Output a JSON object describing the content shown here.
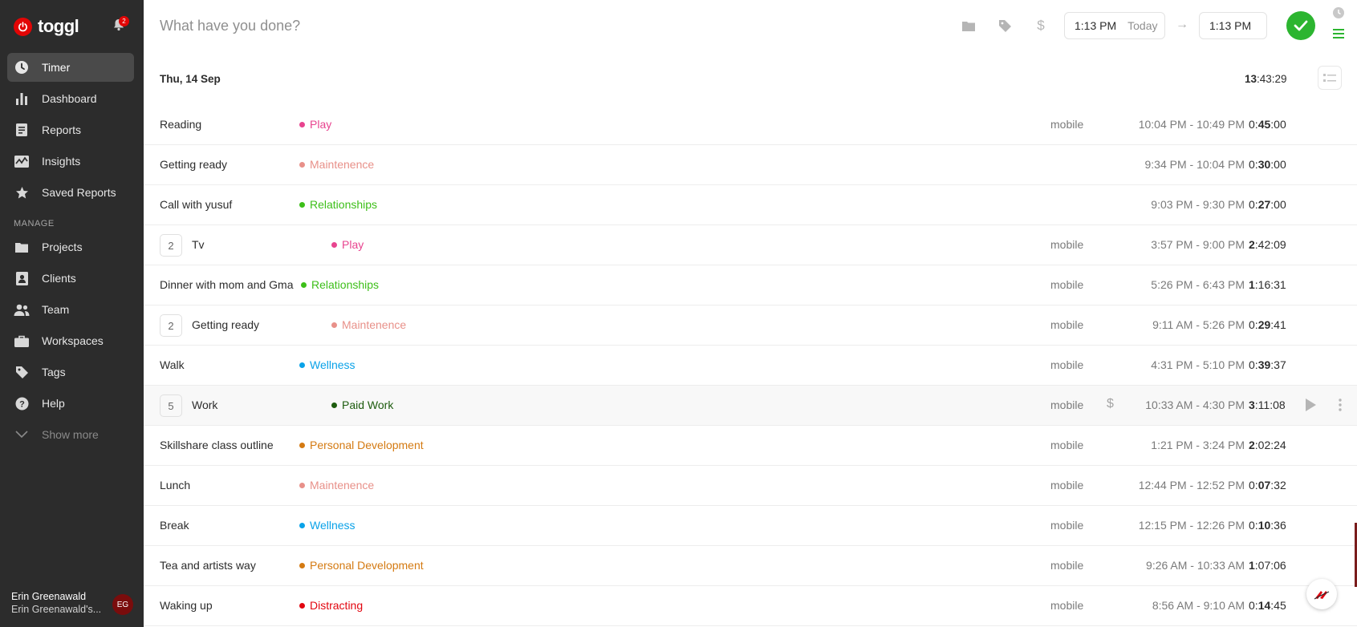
{
  "app": {
    "name": "toggl",
    "notification_count": "2"
  },
  "sidebar": {
    "items": [
      {
        "key": "timer",
        "label": "Timer",
        "icon": "clock-icon",
        "active": true
      },
      {
        "key": "dashboard",
        "label": "Dashboard",
        "icon": "bar-chart-icon"
      },
      {
        "key": "reports",
        "label": "Reports",
        "icon": "document-icon"
      },
      {
        "key": "insights",
        "label": "Insights",
        "icon": "pulse-chart-icon"
      },
      {
        "key": "saved-reports",
        "label": "Saved Reports",
        "icon": "star-icon"
      }
    ],
    "manage_label": "MANAGE",
    "manage_items": [
      {
        "key": "projects",
        "label": "Projects",
        "icon": "folder-icon"
      },
      {
        "key": "clients",
        "label": "Clients",
        "icon": "contact-card-icon"
      },
      {
        "key": "team",
        "label": "Team",
        "icon": "people-icon"
      },
      {
        "key": "workspaces",
        "label": "Workspaces",
        "icon": "briefcase-icon"
      },
      {
        "key": "tags",
        "label": "Tags",
        "icon": "tag-icon"
      },
      {
        "key": "help",
        "label": "Help",
        "icon": "help-icon"
      }
    ],
    "show_more": "Show more",
    "user": {
      "name": "Erin Greenawald",
      "workspace": "Erin Greenawald's...",
      "initials": "EG"
    }
  },
  "timer_bar": {
    "placeholder": "What have you done?",
    "start_time": "1:13 PM",
    "start_day": "Today",
    "end_time": "1:13 PM"
  },
  "day": {
    "title": "Thu, 14 Sep",
    "total_prefix": "13",
    "total_rest": ":43:29"
  },
  "entries": [
    {
      "count": "",
      "description": "Reading",
      "project": "Play",
      "color": "#e8448f",
      "tag": "mobile",
      "billable": false,
      "range": "10:04 PM - 10:49 PM",
      "dur_h": "0:",
      "dur_m": "45",
      "dur_s": ":00"
    },
    {
      "count": "",
      "description": "Getting ready",
      "project": "Maintenence",
      "color": "#e89089",
      "tag": "",
      "billable": false,
      "range": "9:34 PM - 10:04 PM",
      "dur_h": "0:",
      "dur_m": "30",
      "dur_s": ":00"
    },
    {
      "count": "",
      "description": "Call with yusuf",
      "project": "Relationships",
      "color": "#3dbf19",
      "tag": "",
      "billable": false,
      "range": "9:03 PM - 9:30 PM",
      "dur_h": "0:",
      "dur_m": "27",
      "dur_s": ":00"
    },
    {
      "count": "2",
      "description": "Tv",
      "project": "Play",
      "color": "#e8448f",
      "tag": "mobile",
      "billable": false,
      "range": "3:57 PM - 9:00 PM",
      "dur_h": "2",
      "dur_m": "",
      "dur_s": ":42:09"
    },
    {
      "count": "",
      "description": "Dinner with mom and Gma",
      "project": "Relationships",
      "color": "#3dbf19",
      "tag": "mobile",
      "billable": false,
      "range": "5:26 PM - 6:43 PM",
      "dur_h": "1",
      "dur_m": "",
      "dur_s": ":16:31"
    },
    {
      "count": "2",
      "description": "Getting ready",
      "project": "Maintenence",
      "color": "#e89089",
      "tag": "mobile",
      "billable": false,
      "range": "9:11 AM - 5:26 PM",
      "dur_h": "0:",
      "dur_m": "29",
      "dur_s": ":41"
    },
    {
      "count": "",
      "description": "Walk",
      "project": "Wellness",
      "color": "#0aa2e8",
      "tag": "mobile",
      "billable": false,
      "range": "4:31 PM - 5:10 PM",
      "dur_h": "0:",
      "dur_m": "39",
      "dur_s": ":37"
    },
    {
      "count": "5",
      "description": "Work",
      "project": "Paid Work",
      "color": "#1d5c0e",
      "tag": "mobile",
      "billable": true,
      "range": "10:33 AM - 4:30 PM",
      "dur_h": "3",
      "dur_m": "",
      "dur_s": ":11:08",
      "hover": true
    },
    {
      "count": "",
      "description": "Skillshare class outline",
      "project": "Personal Development",
      "color": "#d47a12",
      "tag": "mobile",
      "billable": false,
      "range": "1:21 PM - 3:24 PM",
      "dur_h": "2",
      "dur_m": "",
      "dur_s": ":02:24"
    },
    {
      "count": "",
      "description": "Lunch",
      "project": "Maintenence",
      "color": "#e89089",
      "tag": "mobile",
      "billable": false,
      "range": "12:44 PM - 12:52 PM",
      "dur_h": "0:",
      "dur_m": "07",
      "dur_s": ":32"
    },
    {
      "count": "",
      "description": "Break",
      "project": "Wellness",
      "color": "#0aa2e8",
      "tag": "mobile",
      "billable": false,
      "range": "12:15 PM - 12:26 PM",
      "dur_h": "0:",
      "dur_m": "10",
      "dur_s": ":36"
    },
    {
      "count": "",
      "description": "Tea and artists way",
      "project": "Personal Development",
      "color": "#d47a12",
      "tag": "mobile",
      "billable": false,
      "range": "9:26 AM - 10:33 AM",
      "dur_h": "1",
      "dur_m": "",
      "dur_s": ":07:06"
    },
    {
      "count": "",
      "description": "Waking up",
      "project": "Distracting",
      "color": "#e2050f",
      "tag": "mobile",
      "billable": false,
      "range": "8:56 AM - 9:10 AM",
      "dur_h": "0:",
      "dur_m": "14",
      "dur_s": ":45"
    }
  ]
}
